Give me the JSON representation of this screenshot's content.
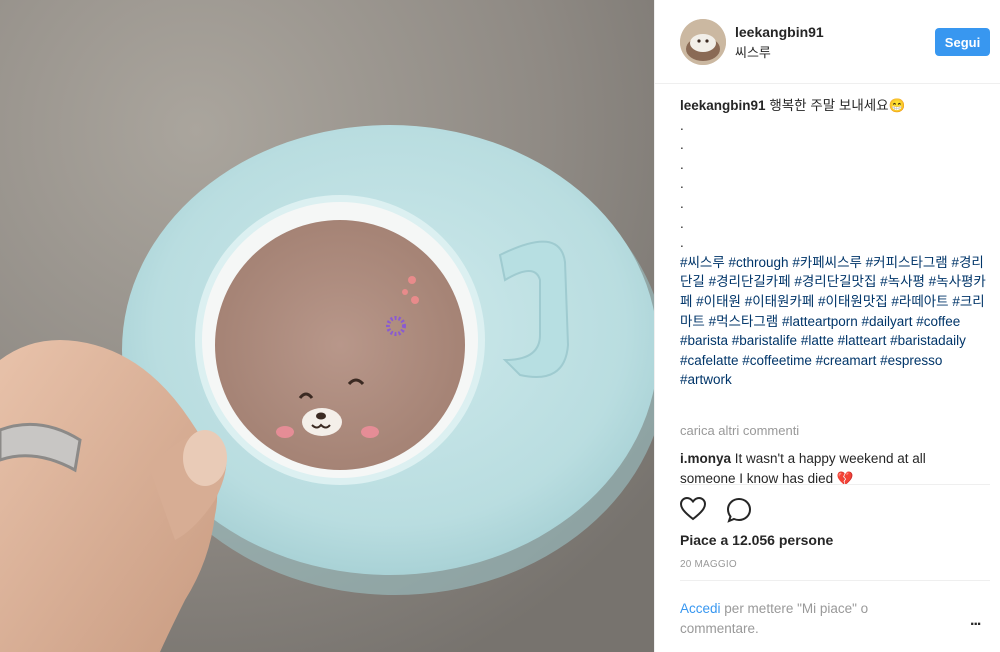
{
  "post": {
    "username": "leekangbin91",
    "location": "씨스루",
    "follow_label": "Segui",
    "caption_user": "leekangbin91",
    "caption_text": "행복한 주말 보내세요",
    "caption_emoji": "😁",
    "caption_dots": [
      ".",
      ".",
      ".",
      ".",
      ".",
      ".",
      "."
    ],
    "hashtags": "#씨스루 #cthrough #카페씨스루 #커피스타그램 #경리단길 #경리단길카페 #경리단길맛집 #녹사평 #녹사평카페 #이태원 #이태원카페 #이태원맛집 #라떼아트 #크리마트 #먹스타그램 #latteartporn #dailyart #coffee #barista #baristalife #latte #latteart #baristadaily #cafelatte #coffeetime #creamart #espresso #artwork",
    "load_more": "carica altri commenti",
    "comment": {
      "user": "i.monya",
      "text": "It wasn't a happy weekend at all someone I know has died",
      "emoji": "💔"
    },
    "likes": "Piace a 12.056 persone",
    "date": "20 MAGGIO",
    "login_link": "Accedi",
    "login_text": "per mettere \"Mi piace\" o commentare.",
    "options": "..."
  },
  "colors": {
    "accent": "#3897f0",
    "hashtag": "#003569",
    "muted": "#999999",
    "saucer": "#bfe1e4"
  },
  "icons": [
    "heart-icon",
    "comment-icon",
    "more-options-icon"
  ]
}
